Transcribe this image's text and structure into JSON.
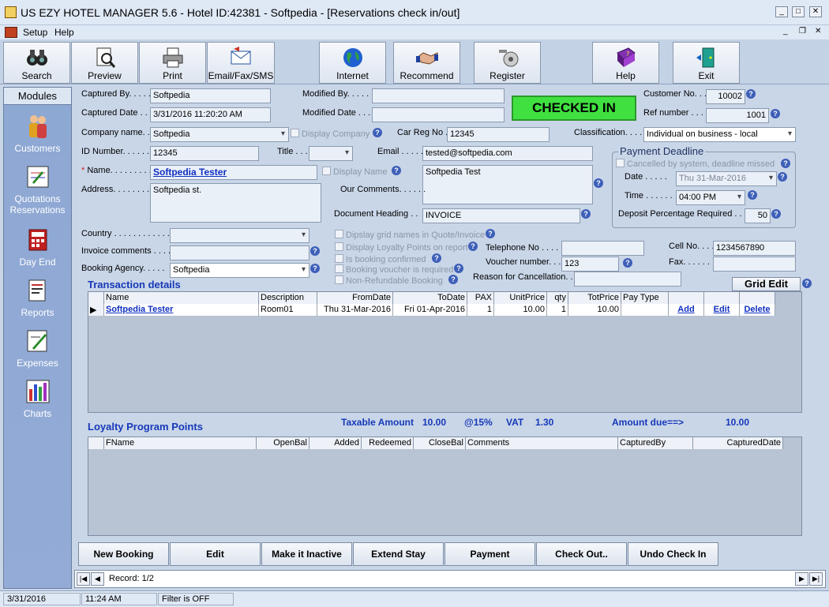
{
  "window": {
    "title": "US EZY HOTEL MANAGER 5.6 - Hotel ID:42381 - Softpedia - [Reservations check in/out]"
  },
  "menu": {
    "setup": "Setup",
    "help": "Help"
  },
  "toolbar": {
    "search": "Search",
    "preview": "Preview",
    "print": "Print",
    "email": "Email/Fax/SMS",
    "internet": "Internet",
    "recommend": "Recommend",
    "register": "Register",
    "help": "Help",
    "exit": "Exit"
  },
  "sidebar": {
    "header": "Modules",
    "items": [
      "Customers",
      "Quotations Reservations",
      "Day End",
      "Reports",
      "Expenses",
      "Charts"
    ]
  },
  "form": {
    "captured_by_label": "Captured By. . . . . .",
    "captured_by": "Softpedia",
    "modified_by_label": "Modified By. . . . .",
    "modified_by": "",
    "status": "CHECKED IN",
    "customer_no_label": "Customer No. . .",
    "customer_no": "10002",
    "captured_date_label": "Captured Date . . .",
    "captured_date": "3/31/2016 11:20:20 AM",
    "modified_date_label": "Modified Date . . .",
    "modified_date": "",
    "ref_number_label": "Ref number . . . .",
    "ref_number": "1001",
    "company_label": "Company name. . . .",
    "company": "Softpedia",
    "display_company": "Display Company",
    "car_reg_label": "Car Reg No . .",
    "car_reg": "12345",
    "classification_label": "Classification. . . . .",
    "classification": "Individual on business - local",
    "id_label": "ID Number. . . . . .",
    "id_number": "12345",
    "title_label": "Title . . .",
    "title_value": "",
    "email_label": "Email . . . . .",
    "email": "tested@softpedia.com",
    "name_label": "Name. . . . . . . . .",
    "name": "Softpedia Tester",
    "display_name": "Display Name",
    "address_label": "Address. . . . . . . . .",
    "address": "Softpedia st.",
    "comments_label": "Our Comments. . . . . .",
    "comments": "Softpedia Test",
    "doc_heading_label": "Document Heading . .",
    "doc_heading": "INVOICE",
    "country_label": "Country . . . . . . . . . . . .",
    "country": "",
    "invoice_comments_label": "Invoice comments . . . .",
    "invoice_comments": "",
    "booking_agency_label": "Booking Agency. . . . .",
    "booking_agency": "Softpedia",
    "chk1": "Dipslay grid names in Quote/Invoice",
    "chk2": "Display Loyalty Points on report",
    "chk3": "Is booking confirmed",
    "chk4": "Booking voucher is required",
    "chk5": "Non-Refundable Booking",
    "telephone_label": "Telephone No . . . .",
    "telephone": "",
    "voucher_label": "Voucher number. . .",
    "voucher": "123",
    "reason_label": "Reason for Cancellation. . .",
    "reason": "",
    "cell_label": "Cell No. . . .",
    "cell": "1234567890",
    "fax_label": "Fax. . . . . . .",
    "fax": ""
  },
  "payment_deadline": {
    "title": "Payment Deadline",
    "cancelled": "Cancelled by system, deadline missed",
    "date_label": "Date . . . . .",
    "date": "Thu 31-Mar-2016",
    "time_label": "Time . . . . . .",
    "time": "04:00 PM",
    "deposit_label": "Deposit Percentage Required . .",
    "deposit": "50"
  },
  "transactions": {
    "title": "Transaction details",
    "grid_edit": "Grid Edit",
    "headers": [
      "Name",
      "Description",
      "FromDate",
      "ToDate",
      "PAX",
      "UnitPrice",
      "qty",
      "TotPrice",
      "Pay Type",
      "",
      "",
      ""
    ],
    "row": {
      "name": "Softpedia Tester",
      "description": "Room01",
      "from": "Thu 31-Mar-2016",
      "to": "Fri 01-Apr-2016",
      "pax": "1",
      "unit_price": "10.00",
      "qty": "1",
      "tot_price": "10.00",
      "pay_type": "",
      "add": "Add",
      "edit": "Edit",
      "delete": "Delete"
    }
  },
  "totals": {
    "taxable_label": "Taxable Amount",
    "taxable": "10.00",
    "rate": "@15%",
    "vat_label": "VAT",
    "vat": "1.30",
    "due_label": "Amount due==>",
    "due": "10.00"
  },
  "loyalty": {
    "title": "Loyalty Program Points",
    "headers": [
      "FName",
      "OpenBal",
      "Added",
      "Redeemed",
      "CloseBal",
      "Comments",
      "CapturedBy",
      "CapturedDate"
    ]
  },
  "buttons": {
    "new_booking": "New Booking",
    "edit": "Edit",
    "inactive": "Make it Inactive",
    "extend": "Extend Stay",
    "payment": "Payment",
    "check_out": "Check Out..",
    "undo": "Undo Check In"
  },
  "navigator": {
    "record": "Record: 1/2"
  },
  "status": {
    "date": "3/31/2016",
    "time": "11:24 AM",
    "filter": "Filter is OFF"
  }
}
